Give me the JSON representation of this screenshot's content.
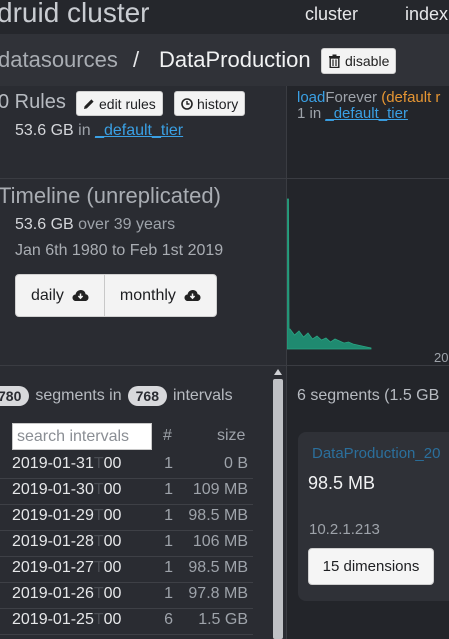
{
  "header": {
    "app_title": "druid cluster",
    "nav": [
      "cluster",
      "index"
    ]
  },
  "breadcrumb": {
    "root": "datasources",
    "separator": "/",
    "current": "DataProduction",
    "disable_label": "disable"
  },
  "rules": {
    "title": "0 Rules",
    "edit_label": "edit rules",
    "history_label": "history",
    "size": "53.6 GB",
    "in_word": "in",
    "tier": "_default_tier",
    "load_rule": "load",
    "load_rule_rest": "Forever",
    "load_default": "(default r",
    "replicants": "1",
    "replicants_in": "in",
    "replicants_tier": "_default_tier"
  },
  "timeline": {
    "title": "Timeline (unreplicated)",
    "size": "53.6 GB",
    "span": "over 39 years",
    "range": "Jan 6th 1980 to Feb 1st 2019",
    "daily_label": "daily",
    "monthly_label": "monthly",
    "axis_year": "20",
    "bar_color": "#1f8a70"
  },
  "segments": {
    "segment_count": "780",
    "segments_word": "segments in",
    "interval_count": "768",
    "intervals_word": "intervals",
    "search_placeholder": "search intervals",
    "col_count": "#",
    "col_size": "size",
    "rows": [
      {
        "date": "2019-01-31",
        "t": "T",
        "hour": "00",
        "count": "1",
        "size": "0 B"
      },
      {
        "date": "2019-01-30",
        "t": "T",
        "hour": "00",
        "count": "1",
        "size": "109 MB"
      },
      {
        "date": "2019-01-29",
        "t": "T",
        "hour": "00",
        "count": "1",
        "size": "98.5 MB"
      },
      {
        "date": "2019-01-28",
        "t": "T",
        "hour": "00",
        "count": "1",
        "size": "106 MB"
      },
      {
        "date": "2019-01-27",
        "t": "T",
        "hour": "00",
        "count": "1",
        "size": "98.5 MB"
      },
      {
        "date": "2019-01-26",
        "t": "T",
        "hour": "00",
        "count": "1",
        "size": "97.8 MB"
      },
      {
        "date": "2019-01-25",
        "t": "T",
        "hour": "00",
        "count": "6",
        "size": "1.5 GB"
      }
    ]
  },
  "segment_detail": {
    "heading": "6 segments (1.5 GB",
    "card_title": "DataProduction_20",
    "card_size": "98.5 MB",
    "card_host": "10.2.1.213",
    "dimensions_label": "15 dimensions"
  }
}
